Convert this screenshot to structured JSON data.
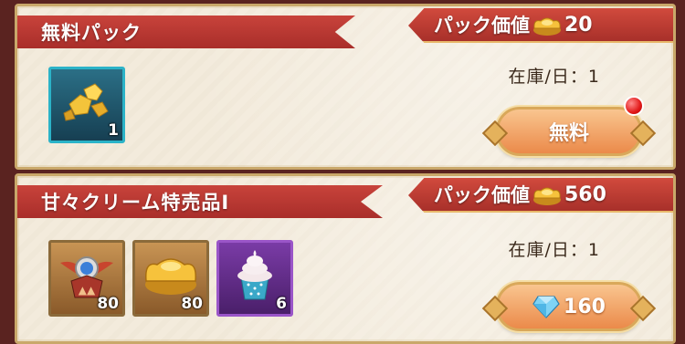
{
  "packs": [
    {
      "title": "無料パック",
      "value_label": "パック価値",
      "value_icon": "gold-ingot-icon",
      "value_amount": "20",
      "stock_text": "在庫/日：1",
      "items": [
        {
          "icon": "gold-nuggets-icon",
          "qty": "1",
          "frame": "teal"
        }
      ],
      "button": {
        "label": "無料",
        "has_notification": true
      }
    },
    {
      "title": "甘々クリーム特売品Ⅰ",
      "value_label": "パック価値",
      "value_icon": "gold-ingot-icon",
      "value_amount": "560",
      "stock_text": "在庫/日：1",
      "items": [
        {
          "icon": "winged-emblem-icon",
          "qty": "80",
          "frame": "bronze"
        },
        {
          "icon": "gold-ingot-icon",
          "qty": "80",
          "frame": "bronze"
        },
        {
          "icon": "cupcake-icon",
          "qty": "6",
          "frame": "purple"
        }
      ],
      "button": {
        "price_icon": "diamond-icon",
        "price": "160"
      }
    }
  ],
  "colors": {
    "ribbon_red": "#b8352f",
    "card_bg": "#f3ebdc",
    "button_orange": "#eb8a4a",
    "gold_border": "#c9a86a"
  }
}
